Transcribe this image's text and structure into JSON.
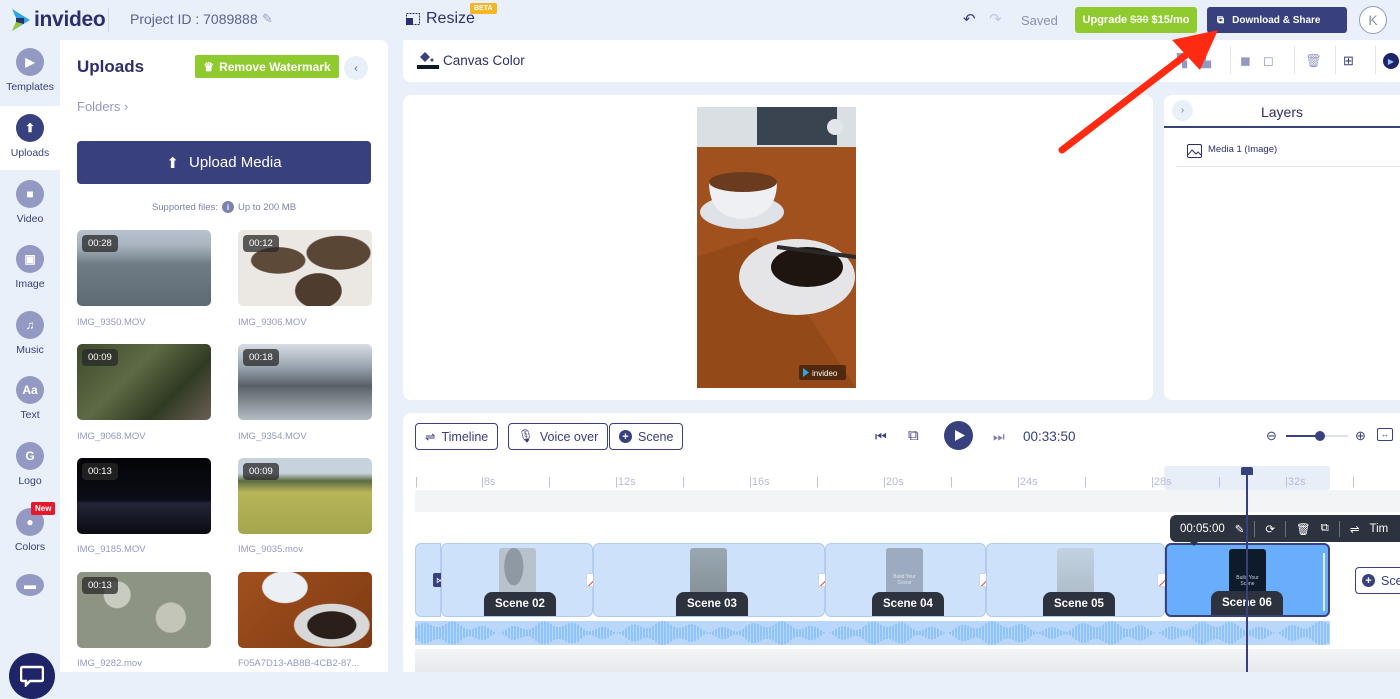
{
  "topbar": {
    "logo_text": "invideo",
    "project_id": "Project ID : 7089888",
    "resize_label": "Resize",
    "beta_badge": "BETA",
    "saved_status": "Saved",
    "upgrade_prefix": "Upgrade",
    "upgrade_old_price": "$30",
    "upgrade_new_price": "$15/mo",
    "download_share_label": "Download & Share",
    "avatar_initial": "K"
  },
  "sidenav": {
    "items": [
      {
        "label": "Templates",
        "icon": "templates-icon"
      },
      {
        "label": "Uploads",
        "icon": "upload-icon",
        "active": true
      },
      {
        "label": "Video",
        "icon": "video-icon"
      },
      {
        "label": "Image",
        "icon": "image-icon"
      },
      {
        "label": "Music",
        "icon": "music-icon"
      },
      {
        "label": "Text",
        "icon": "text-icon"
      },
      {
        "label": "Logo",
        "icon": "logo-icon"
      },
      {
        "label": "Colors",
        "icon": "palette-icon"
      },
      {
        "label": "",
        "icon": "folder-icon"
      }
    ],
    "new_badge": "New",
    "text_icon_glyph": "Aa"
  },
  "uploads_panel": {
    "title": "Uploads",
    "remove_watermark_label": "Remove Watermark",
    "folders_label": "Folders ›",
    "upload_media_label": "Upload Media",
    "supported_files_label": "Supported files:",
    "size_limit": "Up to 200 MB",
    "media": [
      {
        "duration": "00:28",
        "name": "IMG_9350.MOV"
      },
      {
        "duration": "00:12",
        "name": "IMG_9306.MOV"
      },
      {
        "duration": "00:09",
        "name": "IMG_9068.MOV"
      },
      {
        "duration": "00:18",
        "name": "IMG_9354.MOV"
      },
      {
        "duration": "00:13",
        "name": "IMG_9185.MOV"
      },
      {
        "duration": "00:09",
        "name": "IMG_9035.mov"
      },
      {
        "duration": "00:13",
        "name": "IMG_9282.mov"
      },
      {
        "duration": "",
        "name": "F05A7D13-AB8B-4CB2-87..."
      }
    ]
  },
  "canvas": {
    "canvas_color_label": "Canvas Color",
    "watermark_text": "invideo",
    "canvas_color": "#0d1b2a"
  },
  "layers": {
    "title": "Layers",
    "items": [
      {
        "label": "Media 1 (Image)"
      }
    ]
  },
  "timeline": {
    "timeline_button": "Timeline",
    "voiceover_button": "Voice over",
    "scene_button": "Scene",
    "timecode": "00:33:50",
    "zoom_level_fraction": 0.55,
    "ruler_ticks": [
      "8s",
      "12s",
      "16s",
      "20s",
      "24s",
      "28s",
      "32s"
    ],
    "scenes": [
      {
        "label": "Scene 02"
      },
      {
        "label": "Scene 03"
      },
      {
        "label": "Scene 04",
        "thumb_text": "Build Your Scene"
      },
      {
        "label": "Scene 05"
      },
      {
        "label": "Scene 06",
        "thumb_text": "Build Your Scene",
        "active": true
      }
    ],
    "scene_toolbar": {
      "duration": "00:05:00",
      "timing_label": "Tim"
    },
    "add_scene_label": "Sce"
  },
  "colors": {
    "primary": "#38407e",
    "green": "#8fcb2f",
    "new_red": "#e5192b",
    "beta_orange": "#f5b524",
    "active_scene": "#68aefc",
    "annotation_arrow": "#ff2a12"
  }
}
